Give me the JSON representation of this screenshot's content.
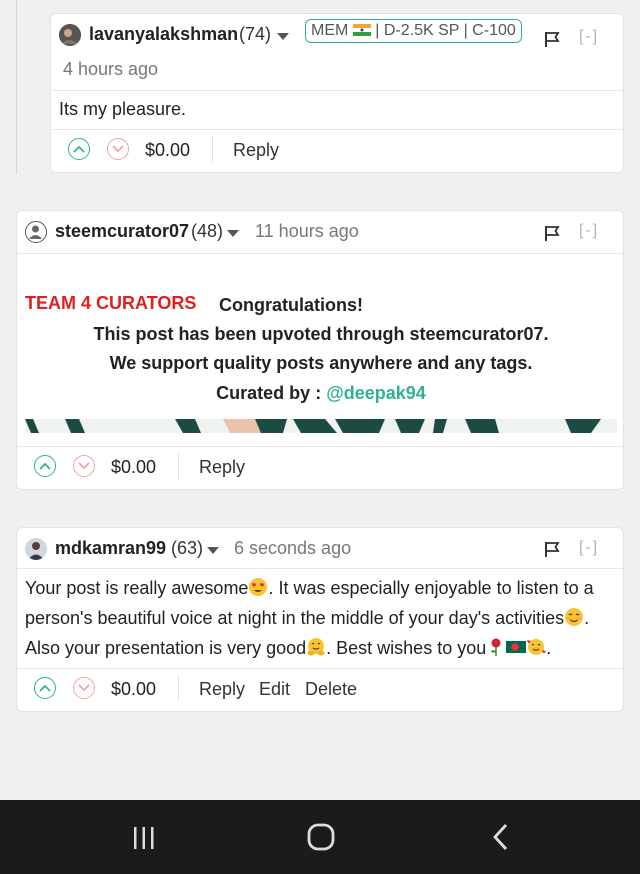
{
  "reply_comment": {
    "author": "lavanyalakshman",
    "reputation": "(74)",
    "badge": {
      "prefix": "MEM",
      "suffix": "| D-2.5K SP | C-100"
    },
    "time": "4 hours ago",
    "collapse_label": "[-]",
    "body": "Its my pleasure.",
    "payout": "$0.00",
    "reply_label": "Reply"
  },
  "curator_comment": {
    "author": "steemcurator07",
    "reputation": "(48)",
    "time": "11 hours ago",
    "collapse_label": "[-]",
    "team_label": "TEAM 4 CURATORS",
    "line1": "Congratulations!",
    "line2": "This post has been upvoted through steemcurator07.",
    "line3": "We support quality posts anywhere and any tags.",
    "curated_by_label": "Curated by :",
    "curator_link": "@deepak94",
    "payout": "$0.00",
    "reply_label": "Reply"
  },
  "own_comment": {
    "author": "mdkamran99",
    "reputation": "(63)",
    "time": "6 seconds ago",
    "collapse_label": "[-]",
    "body_part1": "Your post is really awesome",
    "body_part2": ". It was especially enjoyable to listen to a person's beautiful voice at night in the middle of your day's activities",
    "body_part3": ". Also your presentation is very good",
    "body_part4": ". Best wishes to you",
    "body_part5": ".",
    "payout": "$0.00",
    "reply_label": "Reply",
    "edit_label": "Edit",
    "delete_label": "Delete"
  },
  "colors": {
    "accent": "#2fb394",
    "downvote": "#f0a4a4",
    "team_red": "#e02020",
    "link": "#2fb394"
  },
  "nav": {
    "icons": [
      "recent-apps-icon",
      "home-icon",
      "back-icon"
    ]
  }
}
